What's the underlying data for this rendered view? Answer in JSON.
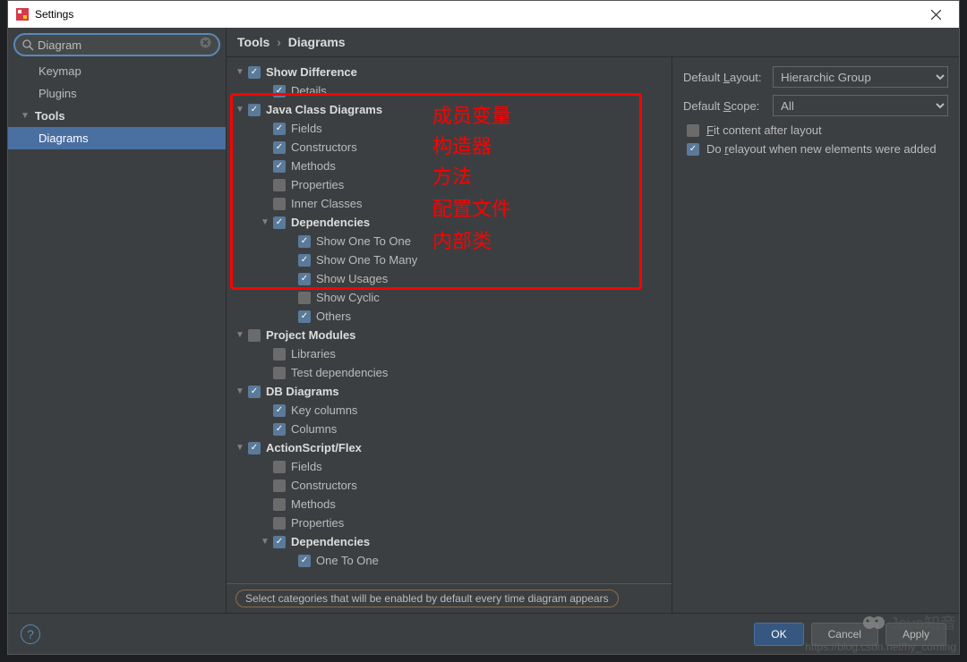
{
  "window": {
    "title": "Settings"
  },
  "search": {
    "value": "Diagram",
    "placeholder": ""
  },
  "sidebar": {
    "items": [
      {
        "label": "Keymap",
        "selected": false,
        "expandable": false
      },
      {
        "label": "Plugins",
        "selected": false,
        "expandable": false
      },
      {
        "label": "Tools",
        "selected": false,
        "expandable": true
      },
      {
        "label": "Diagrams",
        "selected": true,
        "expandable": false
      }
    ]
  },
  "breadcrumb": {
    "root": "Tools",
    "leaf": "Diagrams",
    "sep": "›"
  },
  "tree": [
    {
      "indent": 0,
      "expand": true,
      "checked": true,
      "bold": true,
      "label": "Show Difference"
    },
    {
      "indent": 1,
      "expand": null,
      "checked": true,
      "bold": false,
      "label": "Details"
    },
    {
      "indent": 0,
      "expand": true,
      "checked": true,
      "bold": true,
      "label": "Java Class Diagrams"
    },
    {
      "indent": 1,
      "expand": null,
      "checked": true,
      "bold": false,
      "label": "Fields"
    },
    {
      "indent": 1,
      "expand": null,
      "checked": true,
      "bold": false,
      "label": "Constructors"
    },
    {
      "indent": 1,
      "expand": null,
      "checked": true,
      "bold": false,
      "label": "Methods"
    },
    {
      "indent": 1,
      "expand": null,
      "checked": false,
      "bold": false,
      "label": "Properties"
    },
    {
      "indent": 1,
      "expand": null,
      "checked": false,
      "bold": false,
      "label": "Inner Classes"
    },
    {
      "indent": 1,
      "expand": true,
      "checked": true,
      "bold": true,
      "label": "Dependencies",
      "subindent": true
    },
    {
      "indent": 1,
      "expand": null,
      "checked": true,
      "bold": false,
      "label": "Show One To One",
      "deep": true
    },
    {
      "indent": 1,
      "expand": null,
      "checked": true,
      "bold": false,
      "label": "Show One To Many",
      "deep": true
    },
    {
      "indent": 1,
      "expand": null,
      "checked": true,
      "bold": false,
      "label": "Show Usages",
      "deep": true
    },
    {
      "indent": 1,
      "expand": null,
      "checked": false,
      "bold": false,
      "label": "Show Cyclic",
      "deep": true
    },
    {
      "indent": 1,
      "expand": null,
      "checked": true,
      "bold": false,
      "label": "Others",
      "deep": true
    },
    {
      "indent": 0,
      "expand": true,
      "checked": false,
      "bold": true,
      "label": "Project Modules"
    },
    {
      "indent": 1,
      "expand": null,
      "checked": false,
      "bold": false,
      "label": "Libraries"
    },
    {
      "indent": 1,
      "expand": null,
      "checked": false,
      "bold": false,
      "label": "Test dependencies"
    },
    {
      "indent": 0,
      "expand": true,
      "checked": true,
      "bold": true,
      "label": "DB Diagrams"
    },
    {
      "indent": 1,
      "expand": null,
      "checked": true,
      "bold": false,
      "label": "Key columns"
    },
    {
      "indent": 1,
      "expand": null,
      "checked": true,
      "bold": false,
      "label": "Columns"
    },
    {
      "indent": 0,
      "expand": true,
      "checked": true,
      "bold": true,
      "label": "ActionScript/Flex"
    },
    {
      "indent": 1,
      "expand": null,
      "checked": false,
      "bold": false,
      "label": "Fields"
    },
    {
      "indent": 1,
      "expand": null,
      "checked": false,
      "bold": false,
      "label": "Constructors"
    },
    {
      "indent": 1,
      "expand": null,
      "checked": false,
      "bold": false,
      "label": "Methods"
    },
    {
      "indent": 1,
      "expand": null,
      "checked": false,
      "bold": false,
      "label": "Properties"
    },
    {
      "indent": 1,
      "expand": true,
      "checked": true,
      "bold": true,
      "label": "Dependencies",
      "subindent": true
    },
    {
      "indent": 1,
      "expand": null,
      "checked": true,
      "bold": false,
      "label": "One To One",
      "deep": true
    }
  ],
  "hint": "Select categories that will be enabled by default every time diagram appears",
  "right": {
    "layout_label": "Default Layout:",
    "layout_value": "Hierarchic Group",
    "scope_label": "Default Scope:",
    "scope_value": "All",
    "fit_label": "Fit content after layout",
    "fit_checked": false,
    "relayout_label": "Do relayout when new elements were added",
    "relayout_checked": true
  },
  "annotations": {
    "a0": "成员变量",
    "a1": "构造器",
    "a2": "方法",
    "a3": "配置文件",
    "a4": "内部类"
  },
  "footer": {
    "ok": "OK",
    "cancel": "Cancel",
    "apply": "Apply"
  },
  "watermark": {
    "brand": "Java知音",
    "url": "https://blog.csdn.net/hy_coming"
  }
}
